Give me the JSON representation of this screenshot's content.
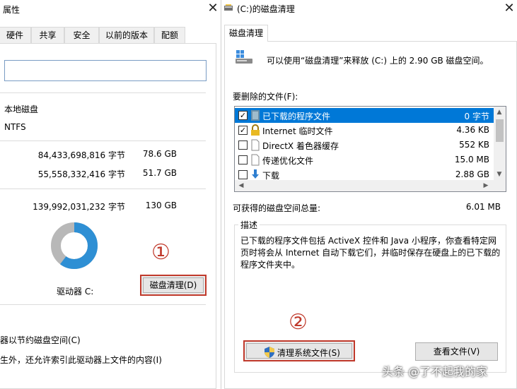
{
  "left_window": {
    "title": "属性",
    "tabs": [
      "硬件",
      "共享",
      "安全",
      "以前的版本",
      "配额"
    ],
    "name_value": "",
    "type_value": "本地磁盘",
    "filesystem_value": "NTFS",
    "used_bytes": "84,433,698,816 字节",
    "used_size": "78.6 GB",
    "free_bytes": "55,558,332,416 字节",
    "free_size": "51.7 GB",
    "capacity_bytes": "139,992,031,232 字节",
    "capacity_size": "130 GB",
    "drive_label": "驱动器 C:",
    "disk_cleanup_button": "磁盘清理(D)",
    "compress_option": "器以节约磁盘空间(C)",
    "index_option": "生外，还允许索引此驱动器上文件的内容(I)",
    "donut_used_fraction": 0.603
  },
  "annotations": {
    "one": "①",
    "two": "②"
  },
  "right_window": {
    "title": "(C:)的磁盘清理",
    "tab": "磁盘清理",
    "intro": "可以使用“磁盘清理”来释放  (C:) 上的 2.90 GB 磁盘空间。",
    "files_label": "要删除的文件(F):",
    "files": [
      {
        "name": "已下载的程序文件",
        "size": "0 字节",
        "checked": true,
        "selected": true,
        "icon": "folder-icon"
      },
      {
        "name": "Internet 临时文件",
        "size": "4.36 KB",
        "checked": true,
        "selected": false,
        "icon": "lock-icon"
      },
      {
        "name": "DirectX 着色器缓存",
        "size": "552 KB",
        "checked": false,
        "selected": false,
        "icon": "file-icon"
      },
      {
        "name": "传递优化文件",
        "size": "15.0 MB",
        "checked": false,
        "selected": false,
        "icon": "file-icon"
      },
      {
        "name": "下载",
        "size": "2.88 GB",
        "checked": false,
        "selected": false,
        "icon": "download-icon"
      }
    ],
    "total_label": "可获得的磁盘空间总量:",
    "total_value": "6.01 MB",
    "description_legend": "描述",
    "description": "已下载的程序文件包括 ActiveX 控件和 Java 小程序，你查看特定网页时将会从 Internet 自动下载它们，并临时保存在硬盘上的已下载的程序文件夹中。",
    "clean_system_button": "清理系统文件(S)",
    "view_files_button": "查看文件(V)"
  },
  "watermark": "头条 @了不起我的家",
  "colors": {
    "selection": "#0078d7",
    "annotation_red": "#c0392b",
    "donut_used": "#2e8fd4",
    "donut_free": "#b8b8b8"
  }
}
